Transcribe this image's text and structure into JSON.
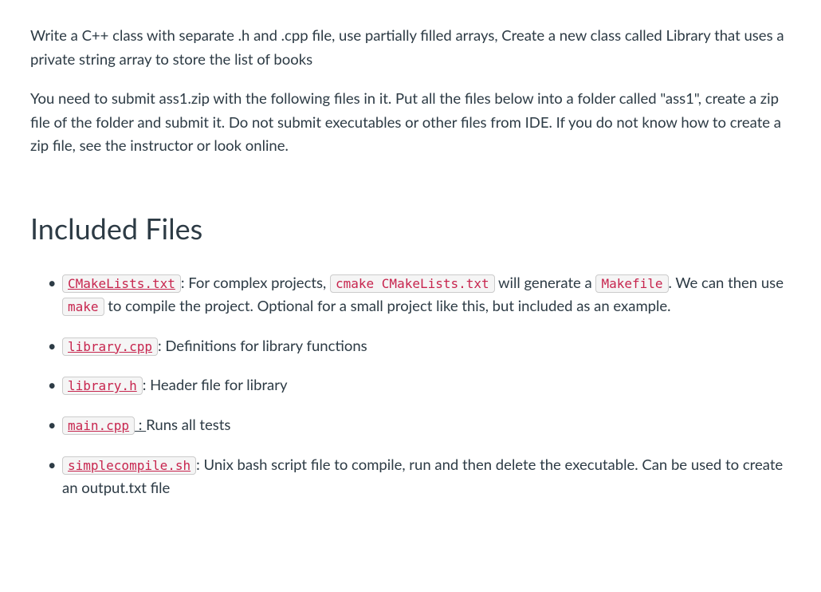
{
  "intro": {
    "para1": "Write a C++ class with separate .h and .cpp file, use partially filled arrays, Create a new class called Library that uses a private string array to store the list of books",
    "para2": "You need to submit ass1.zip with the following files in it. Put all the files below into a folder called \"ass1\", create a zip file of the folder and submit it. Do not submit executables or other files from IDE. If you do not know how to create a zip file, see the instructor or look online."
  },
  "heading": "Included Files",
  "items": {
    "cmake": {
      "code1": "CMakeLists.txt",
      "text1": ": For complex projects, ",
      "code2": "cmake CMakeLists.txt",
      "text2": " will generate a ",
      "code3": "Makefile",
      "text3": ". We can then use ",
      "code4": "make",
      "text4": " to compile the project. Optional for a small project like this, but included as an example."
    },
    "libcpp": {
      "code": "library.cpp",
      "text": ": Definitions for library functions"
    },
    "libh": {
      "code": "library.h",
      "text": ": Header file for library"
    },
    "main": {
      "code": "main.cpp",
      "colon": " : ",
      "text": "Runs all tests"
    },
    "simple": {
      "code": "simplecompile.sh",
      "text": ": Unix bash script file to compile, run and then delete the executable. Can be used to create an output.txt file"
    }
  }
}
